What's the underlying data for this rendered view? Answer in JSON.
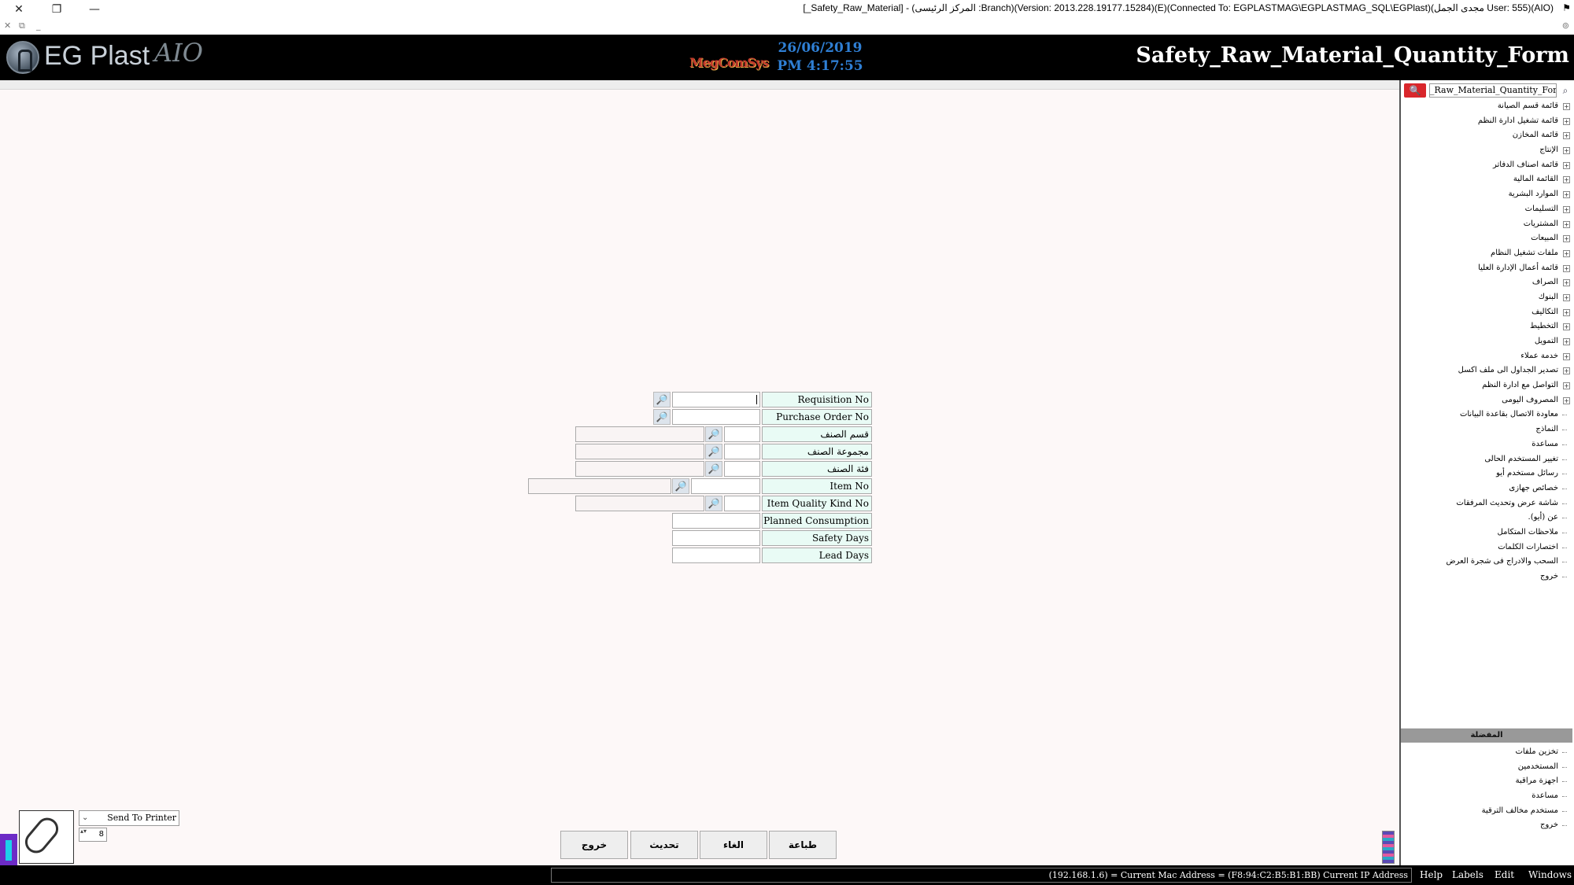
{
  "window": {
    "title": "[_Safety_Raw_Material] - (المركز الرئيسى :Branch)(Version: 2013.228.19177.15284)(E)(Connected To: EGPLASTMAG\\EGPLASTMAG_SQL\\EGPlast)(مجدى الجمل User: 555)(AIO)",
    "close_glyph": "✕",
    "restore_glyph": "❐",
    "minimize_glyph": "—",
    "flag_glyph": "⚑",
    "sub_close": "✕",
    "sub_restore": "⧉",
    "sub_min": "_",
    "sub_right": "⊚"
  },
  "header": {
    "logo_text": "EG Plast",
    "logo_aio": "AIO",
    "brand": "MegComSys",
    "date": "26/06/2019",
    "time": "PM 4:17:55",
    "form_title": "Safety_Raw_Material_Quantity_Form"
  },
  "form": {
    "requisition_no_label": "Requisition No",
    "purchase_order_no_label": "Purchase Order No",
    "item_section_label": "قسم الصنف",
    "item_group_label": "مجموعة الصنف",
    "item_category_label": "فئة الصنف",
    "item_no_label": "Item No",
    "item_quality_kind_no_label": "Item Quality Kind No",
    "planned_consumption_label": "Planned Consumption",
    "safety_days_label": "Safety Days",
    "lead_days_label": "Lead Days",
    "lookup_glyph": "🔎"
  },
  "actions": {
    "print": "طباعة",
    "cancel": "الغاء",
    "update": "تحديث",
    "exit": "خروج"
  },
  "printer": {
    "selected": "Send To Printer",
    "copies": "8",
    "chevron": "⌄",
    "spin": "▴▾"
  },
  "sidebar": {
    "search_value": "_Raw_Material_Quantity_Form",
    "search_btn_glyph": "🔍",
    "search_icon_glyph": "⌕",
    "tree": [
      {
        "label": "قائمة قسم الصيانة",
        "expandable": true
      },
      {
        "label": "قائمة تشغيل ادارة النظم",
        "expandable": true
      },
      {
        "label": "قائمة المخازن",
        "expandable": true
      },
      {
        "label": "الإنتاج",
        "expandable": true
      },
      {
        "label": "قائمة اصناف الدفاتر",
        "expandable": true
      },
      {
        "label": "القائمة المالية",
        "expandable": true
      },
      {
        "label": "الموارد البشرية",
        "expandable": true
      },
      {
        "label": "التسليمات",
        "expandable": true
      },
      {
        "label": "المشتريات",
        "expandable": true
      },
      {
        "label": "المبيعات",
        "expandable": true
      },
      {
        "label": "ملفات تشغيل النظام",
        "expandable": true
      },
      {
        "label": "قائمة أعمال الإدارة العليا",
        "expandable": true
      },
      {
        "label": "الصراف",
        "expandable": true
      },
      {
        "label": "البنوك",
        "expandable": true
      },
      {
        "label": "التكاليف",
        "expandable": true
      },
      {
        "label": "التخطيط",
        "expandable": true
      },
      {
        "label": "التمويل",
        "expandable": true
      },
      {
        "label": "خدمة عملاء",
        "expandable": true
      },
      {
        "label": "تصدير الجداول الى ملف اكسل",
        "expandable": true
      },
      {
        "label": "التواصل مع ادارة النظم",
        "expandable": true
      },
      {
        "label": "المصروف اليومى",
        "expandable": true
      },
      {
        "label": "معاودة الاتصال بقاعدة البيانات",
        "expandable": false
      },
      {
        "label": "النماذج",
        "expandable": false
      },
      {
        "label": "مساعدة",
        "expandable": false
      },
      {
        "label": "تغيير المستخدم الحالى",
        "expandable": false
      },
      {
        "label": "رسائل مستخدم أيو",
        "expandable": false
      },
      {
        "label": "خصائص جهازى",
        "expandable": false
      },
      {
        "label": "شاشة عرض وتحديث المرفقات",
        "expandable": false
      },
      {
        "label": "عن (أيو).",
        "expandable": false
      },
      {
        "label": "ملاحظات المتكامل",
        "expandable": false
      },
      {
        "label": "اختصارات الكلمات",
        "expandable": false
      },
      {
        "label": "السحب والادراج فى شجرة العرض",
        "expandable": false
      },
      {
        "label": "خروج",
        "expandable": false
      }
    ],
    "favorites_header": "المفضلة",
    "favorites": [
      "تخزين ملفات",
      "المستخدمين",
      "اجهزة مراقبة",
      "مساعدة",
      "مستخدم مخالف الترقية",
      "خروج"
    ],
    "expand_glyph": "+"
  },
  "status": {
    "text": "(192.168.1.6) = Current Mac Address = (F8:94:C2:B5:B1:BB) Current IP Address",
    "menu": [
      "Help",
      "Labels",
      "Edit",
      "Windows"
    ]
  }
}
